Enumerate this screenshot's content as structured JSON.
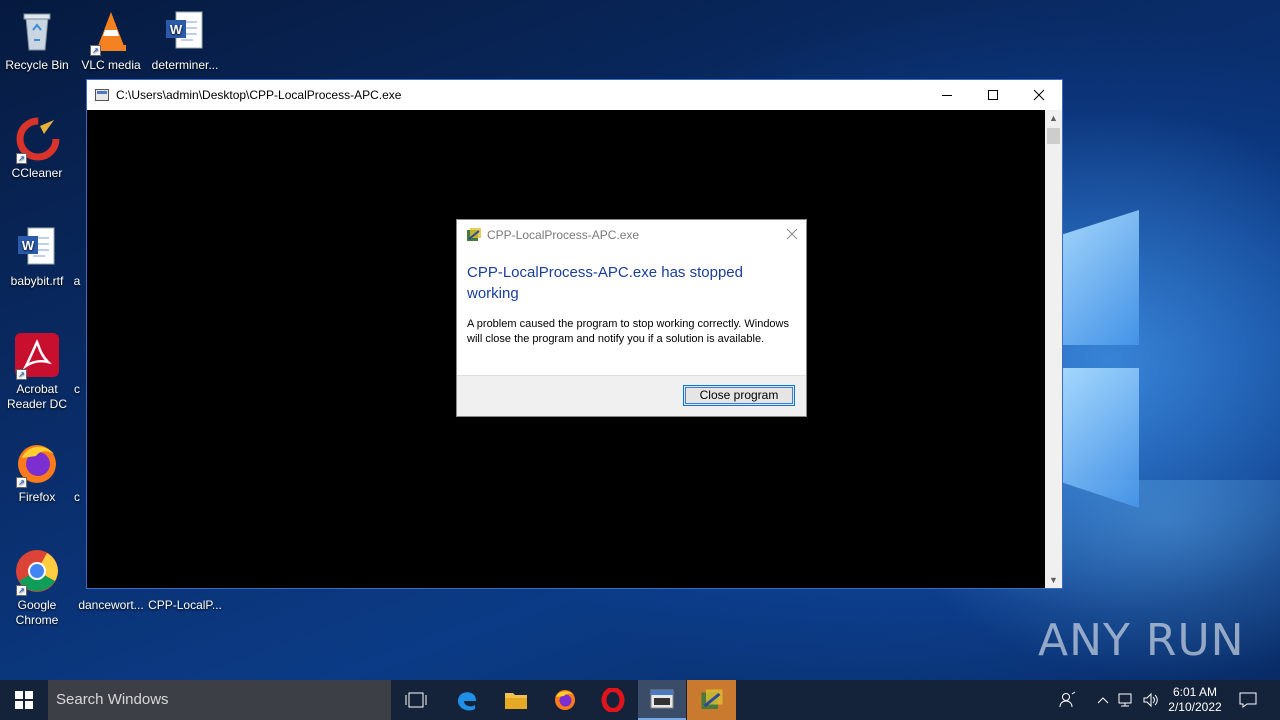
{
  "desktop": {
    "icons": [
      {
        "label": "Recycle Bin"
      },
      {
        "label": "VLC media"
      },
      {
        "label": "determiner..."
      },
      {
        "label": "CCleaner"
      },
      {
        "label": "babybit.rtf"
      },
      {
        "label": "Acrobat Reader DC"
      },
      {
        "label": "Firefox"
      },
      {
        "label": "Google Chrome"
      },
      {
        "label": "dancewort..."
      },
      {
        "label": "CPP-LocalP..."
      }
    ],
    "partial_labels": [
      "a",
      "c",
      "c"
    ]
  },
  "console": {
    "title": "C:\\Users\\admin\\Desktop\\CPP-LocalProcess-APC.exe"
  },
  "dialog": {
    "title": "CPP-LocalProcess-APC.exe",
    "heading": "CPP-LocalProcess-APC.exe has stopped working",
    "message": "A problem caused the program to stop working correctly. Windows will close the program and notify you if a solution is available.",
    "close_button": "Close program"
  },
  "watermark": {
    "text": "ANY RUN"
  },
  "taskbar": {
    "search_placeholder": "Search Windows",
    "time": "6:01 AM",
    "date": "2/10/2022"
  }
}
